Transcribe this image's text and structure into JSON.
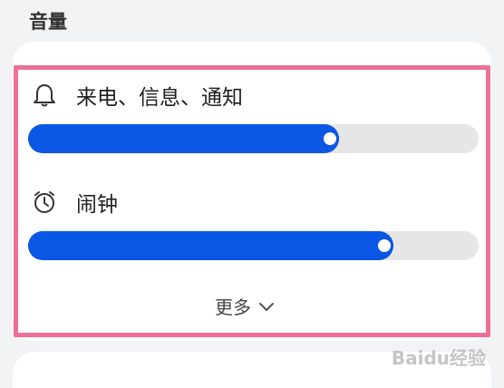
{
  "section": {
    "title": "音量"
  },
  "rows": [
    {
      "label": "来电、信息、通知",
      "icon": "bell-icon",
      "level": 0.69
    },
    {
      "label": "闹钟",
      "icon": "alarm-clock-icon",
      "level": 0.81
    }
  ],
  "more": {
    "label": "更多"
  },
  "colors": {
    "accent": "#0a57e5",
    "track": "#e6e6e6",
    "highlight": "#ee6f95",
    "background": "#f1f3f5"
  },
  "watermark": {
    "text": "Baidu经验"
  }
}
